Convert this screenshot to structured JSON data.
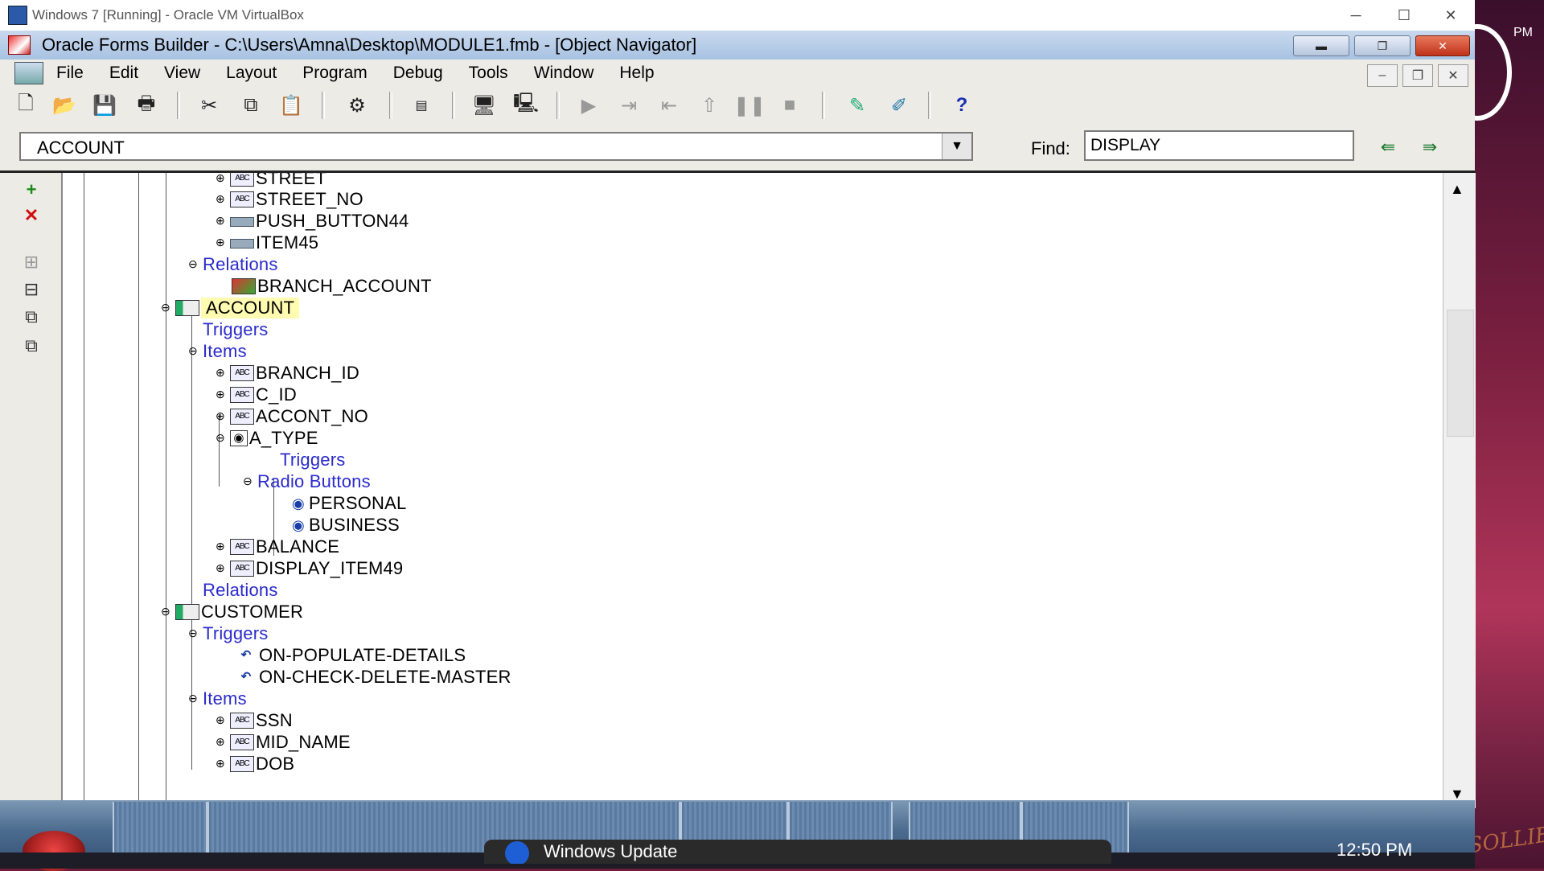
{
  "vbox": {
    "title": "Windows 7 [Running] - Oracle VM VirtualBox",
    "minimize": "─",
    "maximize": "☐",
    "close": "✕"
  },
  "forms": {
    "title": "Oracle Forms Builder - C:\\Users\\Amna\\Desktop\\MODULE1.fmb - [Object Navigator]"
  },
  "menu": [
    "File",
    "Edit",
    "View",
    "Layout",
    "Program",
    "Debug",
    "Tools",
    "Window",
    "Help"
  ],
  "findbar": {
    "block_value": "ACCOUNT",
    "find_label": "Find:",
    "find_value": "DISPLAY"
  },
  "tree": {
    "nodes": [
      {
        "label": "STREET"
      },
      {
        "label": "STREET_NO"
      },
      {
        "label": "PUSH_BUTTON44"
      },
      {
        "label": "ITEM45"
      },
      {
        "label": "Relations"
      },
      {
        "label": "BRANCH_ACCOUNT"
      },
      {
        "label": "ACCOUNT"
      },
      {
        "label": "Triggers"
      },
      {
        "label": "Items"
      },
      {
        "label": "BRANCH_ID"
      },
      {
        "label": "C_ID"
      },
      {
        "label": "ACCONT_NO"
      },
      {
        "label": "A_TYPE"
      },
      {
        "label": "Triggers"
      },
      {
        "label": "Radio Buttons"
      },
      {
        "label": "PERSONAL"
      },
      {
        "label": "BUSINESS"
      },
      {
        "label": "BALANCE"
      },
      {
        "label": "DISPLAY_ITEM49"
      },
      {
        "label": "Relations"
      },
      {
        "label": "CUSTOMER"
      },
      {
        "label": "Triggers"
      },
      {
        "label": "ON-POPULATE-DETAILS"
      },
      {
        "label": "ON-CHECK-DELETE-MASTER"
      },
      {
        "label": "Items"
      },
      {
        "label": "SSN"
      },
      {
        "label": "MID_NAME"
      },
      {
        "label": "DOB"
      }
    ]
  },
  "desktop": {
    "time_fragment": "PM",
    "signature": "RSOLLIER",
    "clock": "12:50 PM",
    "notification": "Windows Update"
  }
}
